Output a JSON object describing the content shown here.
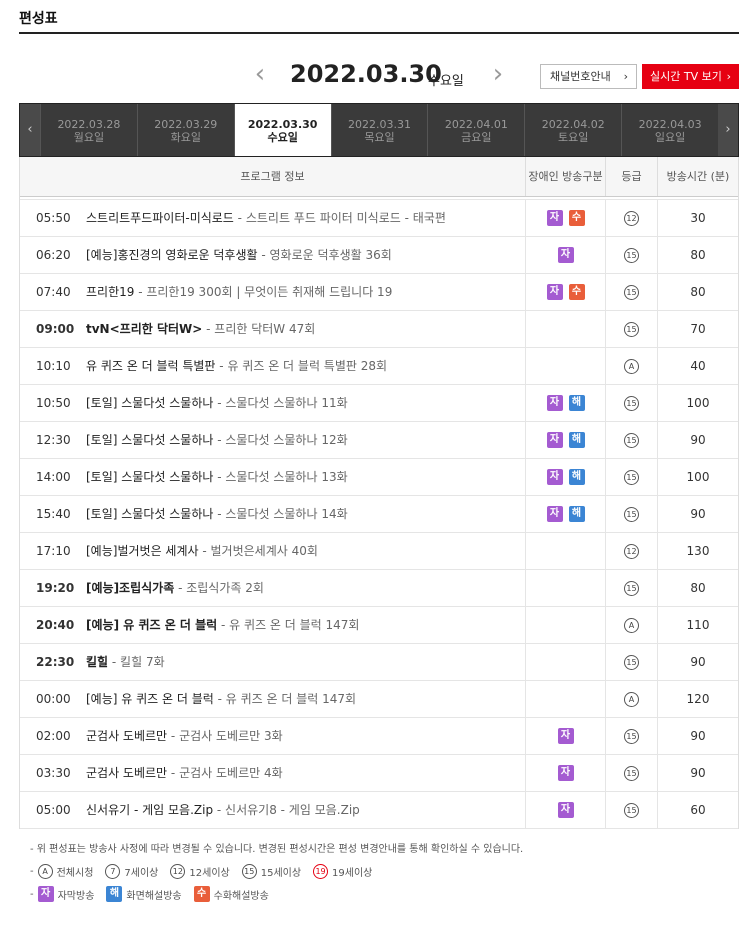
{
  "page": {
    "title": "편성표"
  },
  "date_nav": {
    "prev": "‹",
    "next": "›",
    "date": "2022.03.30",
    "day": "수요일",
    "channel_button": "채널번호안내",
    "live_button": "실시간 TV 보기",
    "chevron": "›"
  },
  "date_tabs": {
    "prev": "‹",
    "next": "›",
    "items": [
      {
        "date": "2022.03.28",
        "day": "월요일"
      },
      {
        "date": "2022.03.29",
        "day": "화요일"
      },
      {
        "date": "2022.03.30",
        "day": "수요일"
      },
      {
        "date": "2022.03.31",
        "day": "목요일"
      },
      {
        "date": "2022.04.01",
        "day": "금요일"
      },
      {
        "date": "2022.04.02",
        "day": "토요일"
      },
      {
        "date": "2022.04.03",
        "day": "일요일"
      }
    ],
    "active_index": 2
  },
  "table": {
    "headers": {
      "info": "프로그램 정보",
      "kind": "장애인 방송구분",
      "grade": "등급",
      "duration": "방송시간 (분)"
    },
    "rows": [
      {
        "time": "05:50",
        "title": "스트리트푸드파이터-미식로드",
        "sub": " - 스트리트 푸드 파이터 미식로드 - 태국편",
        "badges": [
          "자",
          "수"
        ],
        "grade": "12",
        "duration": "30",
        "bold": false
      },
      {
        "time": "06:20",
        "title": "[예능]홍진경의 영화로운 덕후생활",
        "sub": " - 영화로운 덕후생활 36회",
        "badges": [
          "자"
        ],
        "grade": "15",
        "duration": "80",
        "bold": false
      },
      {
        "time": "07:40",
        "title": "프리한19",
        "sub": " - 프리한19 300회 | 무엇이든 취재해 드립니다 19",
        "badges": [
          "자",
          "수"
        ],
        "grade": "15",
        "duration": "80",
        "bold": false
      },
      {
        "time": "09:00",
        "title": "tvN<프리한 닥터W>",
        "sub": " - 프리한 닥터W 47회",
        "badges": [],
        "grade": "15",
        "duration": "70",
        "bold": true
      },
      {
        "time": "10:10",
        "title": "유 퀴즈 온 더 블럭 특별판",
        "sub": " - 유 퀴즈 온 더 블럭 특별판 28회",
        "badges": [],
        "grade": "A",
        "duration": "40",
        "bold": false
      },
      {
        "time": "10:50",
        "title": "[토일] 스물다섯 스물하나",
        "sub": " - 스물다섯 스물하나 11화",
        "badges": [
          "자",
          "해"
        ],
        "grade": "15",
        "duration": "100",
        "bold": false
      },
      {
        "time": "12:30",
        "title": "[토일] 스물다섯 스물하나",
        "sub": " - 스물다섯 스물하나 12화",
        "badges": [
          "자",
          "해"
        ],
        "grade": "15",
        "duration": "90",
        "bold": false
      },
      {
        "time": "14:00",
        "title": "[토일] 스물다섯 스물하나",
        "sub": " - 스물다섯 스물하나 13화",
        "badges": [
          "자",
          "해"
        ],
        "grade": "15",
        "duration": "100",
        "bold": false
      },
      {
        "time": "15:40",
        "title": "[토일] 스물다섯 스물하나",
        "sub": " - 스물다섯 스물하나 14화",
        "badges": [
          "자",
          "해"
        ],
        "grade": "15",
        "duration": "90",
        "bold": false
      },
      {
        "time": "17:10",
        "title": "[예능]벌거벗은 세계사",
        "sub": " - 벌거벗은세계사 40회",
        "badges": [],
        "grade": "12",
        "duration": "130",
        "bold": false
      },
      {
        "time": "19:20",
        "title": "[예능]조립식가족",
        "sub": " - 조립식가족 2회",
        "badges": [],
        "grade": "15",
        "duration": "80",
        "bold": true
      },
      {
        "time": "20:40",
        "title": "[예능] 유 퀴즈 온 더 블럭",
        "sub": " - 유 퀴즈 온 더 블럭 147회",
        "badges": [],
        "grade": "A",
        "duration": "110",
        "bold": true
      },
      {
        "time": "22:30",
        "title": "킬힐",
        "sub": " - 킬힐 7화",
        "badges": [],
        "grade": "15",
        "duration": "90",
        "bold": true
      },
      {
        "time": "00:00",
        "title": "[예능] 유 퀴즈 온 더 블럭",
        "sub": " - 유 퀴즈 온 더 블럭 147회",
        "badges": [],
        "grade": "A",
        "duration": "120",
        "bold": false
      },
      {
        "time": "02:00",
        "title": "군검사 도베르만",
        "sub": " - 군검사 도베르만 3화",
        "badges": [
          "자"
        ],
        "grade": "15",
        "duration": "90",
        "bold": false
      },
      {
        "time": "03:30",
        "title": "군검사 도베르만",
        "sub": " - 군검사 도베르만 4화",
        "badges": [
          "자"
        ],
        "grade": "15",
        "duration": "90",
        "bold": false
      },
      {
        "time": "05:00",
        "title": "신서유기 - 게임 모음.Zip",
        "sub": " - 신서유기8 - 게임 모음.Zip",
        "badges": [
          "자"
        ],
        "grade": "15",
        "duration": "60",
        "bold": false
      }
    ]
  },
  "notes": {
    "line1": "- 위 편성표는 방송사 사정에 따라 변경될 수 있습니다. 변경된 편성시간은 편성 변경안내를 통해 확인하실 수 있습니다.",
    "dash": "-",
    "grades": [
      {
        "mark": "A",
        "label": "전체시청"
      },
      {
        "mark": "7",
        "label": "7세이상"
      },
      {
        "mark": "12",
        "label": "12세이상"
      },
      {
        "mark": "15",
        "label": "15세이상"
      },
      {
        "mark": "19",
        "label": "19세이상"
      }
    ],
    "kinds": [
      {
        "mark": "자",
        "label": "자막방송"
      },
      {
        "mark": "해",
        "label": "화면해설방송"
      },
      {
        "mark": "수",
        "label": "수화해설방송"
      }
    ]
  },
  "colors": {
    "accent": "#e60012",
    "ja": "#a45bd1",
    "su": "#e95e3a",
    "hae": "#3b85d4"
  }
}
